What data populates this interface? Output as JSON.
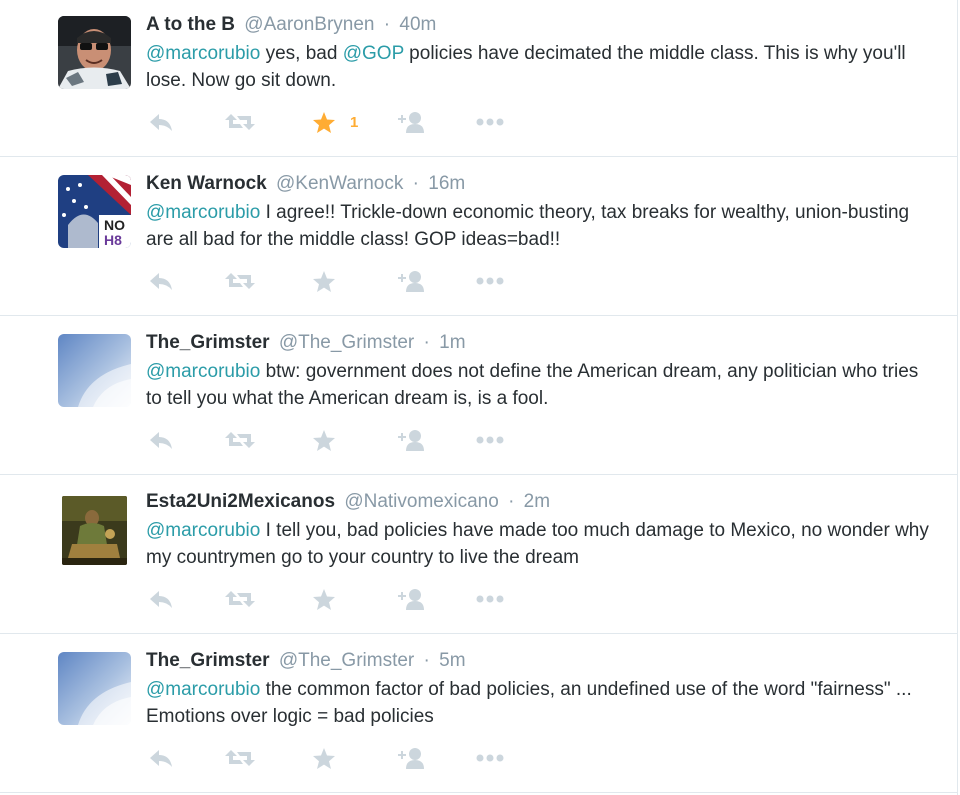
{
  "tweets": [
    {
      "fullname": "A to the B",
      "username": "@AaronBrynen",
      "separator": "·",
      "time": "40m",
      "text_parts": [
        {
          "t": "@marcorubio",
          "mention": true
        },
        {
          "t": " yes, bad ",
          "mention": false
        },
        {
          "t": "@GOP",
          "mention": true
        },
        {
          "t": " policies have decimated the middle class. This is why you'll lose. Now go sit down.",
          "mention": false
        }
      ],
      "favorited": true,
      "fav_count": "1",
      "avatar": "avatar-sunglasses-man"
    },
    {
      "fullname": "Ken Warnock",
      "username": "@KenWarnock",
      "separator": "·",
      "time": "16m",
      "text_parts": [
        {
          "t": "@marcorubio",
          "mention": true
        },
        {
          "t": " I agree!! Trickle-down economic theory, tax breaks for wealthy, union-busting are all bad for the middle class! GOP ideas=bad!!",
          "mention": false
        }
      ],
      "favorited": false,
      "fav_count": "",
      "avatar": "avatar-noh8-flag",
      "avatar_text": [
        "NO",
        "H8"
      ]
    },
    {
      "fullname": "The_Grimster",
      "username": "@The_Grimster",
      "separator": "·",
      "time": "1m",
      "text_parts": [
        {
          "t": "@marcorubio",
          "mention": true
        },
        {
          "t": " btw: government does not define the American dream, any politician who tries to tell you what the American dream is, is a fool.",
          "mention": false
        }
      ],
      "favorited": false,
      "fav_count": "",
      "avatar": "avatar-sky-clouds"
    },
    {
      "fullname": "Esta2Uni2Mexicanos",
      "username": "@Nativomexicano",
      "separator": "·",
      "time": "2m",
      "text_parts": [
        {
          "t": "@marcorubio",
          "mention": true
        },
        {
          "t": " I tell you, bad policies have made too much damage to Mexico, no wonder why my countrymen go to your country to live the dream",
          "mention": false
        }
      ],
      "favorited": false,
      "fav_count": "",
      "avatar": "avatar-painting"
    },
    {
      "fullname": "The_Grimster",
      "username": "@The_Grimster",
      "separator": "·",
      "time": "5m",
      "text_parts": [
        {
          "t": "@marcorubio",
          "mention": true
        },
        {
          "t": " the common factor of bad policies, an undefined use of the word \"fairness\" ... Emotions over logic = bad policies",
          "mention": false
        }
      ],
      "favorited": false,
      "fav_count": "",
      "avatar": "avatar-sky-clouds"
    }
  ],
  "actions": [
    "reply-icon",
    "retweet-icon",
    "favorite-icon",
    "follow-icon",
    "more-icon"
  ],
  "colors": {
    "mention": "#2b9ca8",
    "muted": "#8899a6",
    "icon": "#ccd6dd",
    "favorited": "#ffac33",
    "divider": "#e1e8ed",
    "text": "#292f33"
  }
}
